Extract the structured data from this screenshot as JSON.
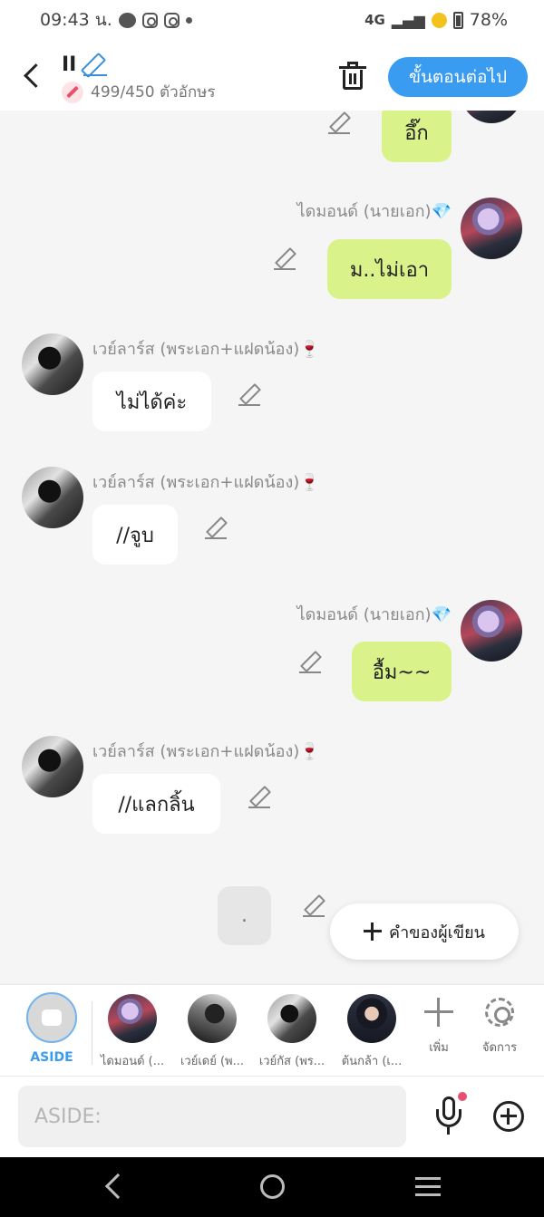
{
  "status_bar": {
    "time": "09:43 น.",
    "network": "4G",
    "battery": "78%"
  },
  "header": {
    "title": "II",
    "char_count": "499/450 ตัวอักษร",
    "next_label": "ขั้นตอนต่อไป"
  },
  "messages": [
    {
      "side": "right",
      "sender": "",
      "text": "อึ๊ก"
    },
    {
      "side": "right",
      "sender": "ไดมอนด์ (นายเอก)💎",
      "text": "ม..ไม่เอา"
    },
    {
      "side": "left",
      "sender": "เวย์ลาร์ส (พระเอก+แฝดน้อง)🍷",
      "text": "ไม่ได้ค่ะ"
    },
    {
      "side": "left",
      "sender": "เวย์ลาร์ส (พระเอก+แฝดน้อง)🍷",
      "text": "//จูบ"
    },
    {
      "side": "right",
      "sender": "ไดมอนด์ (นายเอก)💎",
      "text": "อื้ม~~"
    },
    {
      "side": "left",
      "sender": "เวย์ลาร์ส (พระเอก+แฝดน้อง)🍷",
      "text": "//แลกลิ้น"
    },
    {
      "side": "right",
      "sender": "",
      "text": "."
    }
  ],
  "author_button": "คำของผู้เขียน",
  "char_bar": {
    "aside_label": "ASIDE",
    "characters": [
      "ไดมอนด์ (...",
      "เวย์เดย์ (พ...",
      "เวย์กัส (พร...",
      "ต้นกล้า (เ..."
    ],
    "add_label": "เพิ่ม",
    "manage_label": "จัดการ"
  },
  "input": {
    "placeholder": "ASIDE:"
  }
}
